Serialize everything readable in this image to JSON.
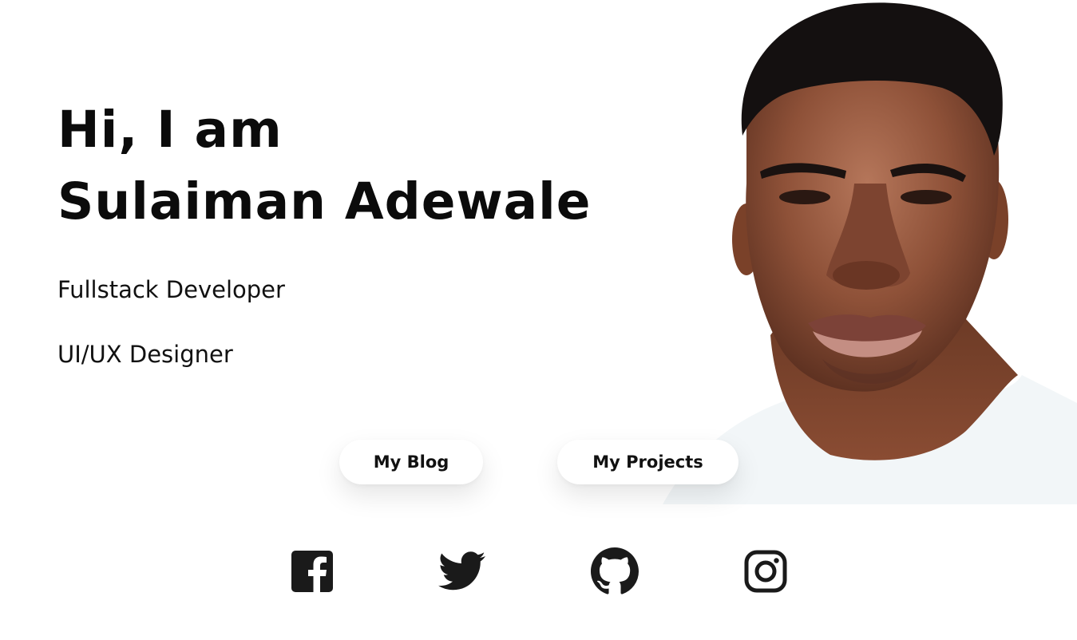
{
  "hero": {
    "greeting": "Hi, I am",
    "name": "Sulaiman Adewale",
    "roles": [
      "Fullstack Developer",
      "UI/UX Designer"
    ]
  },
  "buttons": {
    "blog": "My Blog",
    "projects": "My Projects"
  },
  "social": [
    {
      "name": "facebook",
      "icon": "facebook-icon"
    },
    {
      "name": "twitter",
      "icon": "twitter-icon"
    },
    {
      "name": "github",
      "icon": "github-icon"
    },
    {
      "name": "instagram",
      "icon": "instagram-icon"
    }
  ],
  "colors": {
    "text": "#111111",
    "background": "#ffffff"
  }
}
